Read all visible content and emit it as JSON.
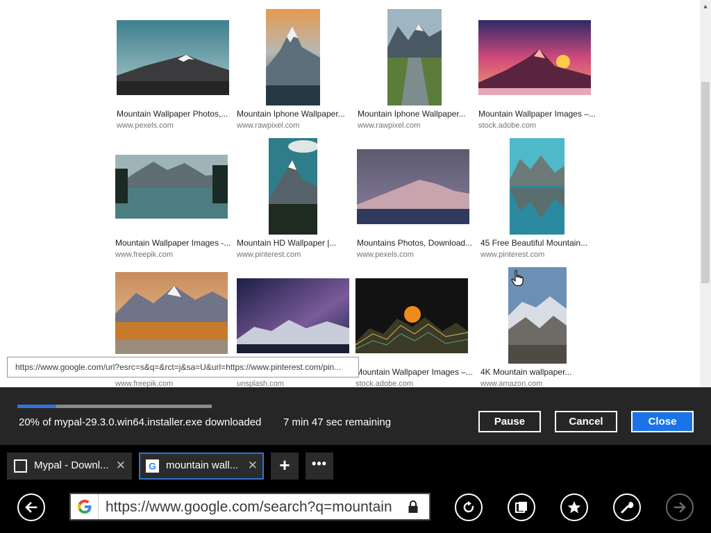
{
  "results": [
    {
      "title": "Mountain Wallpaper Photos,...",
      "domain": "www.pexels.com"
    },
    {
      "title": "Mountain Iphone Wallpaper...",
      "domain": "www.rawpixel.com"
    },
    {
      "title": "Mountain Iphone Wallpaper...",
      "domain": "www.rawpixel.com"
    },
    {
      "title": "Mountain Wallpaper Images –...",
      "domain": "stock.adobe.com"
    },
    {
      "title": "Mountain Wallpaper Images -...",
      "domain": "www.freepik.com"
    },
    {
      "title": "Mountain HD Wallpaper |...",
      "domain": "www.pinterest.com"
    },
    {
      "title": "Mountains Photos, Download...",
      "domain": "www.pexels.com"
    },
    {
      "title": "45 Free Beautiful Mountain...",
      "domain": "www.pinterest.com"
    },
    {
      "title": "",
      "domain": "www.freepik.com"
    },
    {
      "title": "",
      "domain": "unsplash.com"
    },
    {
      "title": "Mountain Wallpaper Images –...",
      "domain": "stock.adobe.com"
    },
    {
      "title": "4K Mountain wallpaper...",
      "domain": "www.amazon.com"
    }
  ],
  "tooltip": {
    "url": "https://www.google.com/url?esrc=s&q=&rct=j&sa=U&url=https://www.pinterest.com/pin..."
  },
  "download": {
    "progress": 0.2,
    "status": "20% of mypal-29.3.0.win64.installer.exe downloaded",
    "remaining": "7 min 47 sec remaining",
    "pause_label": "Pause",
    "cancel_label": "Cancel",
    "close_label": "Close",
    "accent": "#1a73e8"
  },
  "tabs": [
    {
      "label": "Mypal - Downl...",
      "icon": "page-icon",
      "active": false
    },
    {
      "label": "mountain wall...",
      "icon": "google-icon",
      "active": true
    }
  ],
  "tab_strip": {
    "new_tab_label": "+",
    "menu_label": "•••",
    "close_glyph": "✕"
  },
  "nav": {
    "url": "https://www.google.com/search?q=mountain",
    "buttons": [
      "back-icon",
      "reload-icon",
      "tabs-icon",
      "favorite-icon",
      "tools-icon",
      "forward-icon"
    ]
  }
}
